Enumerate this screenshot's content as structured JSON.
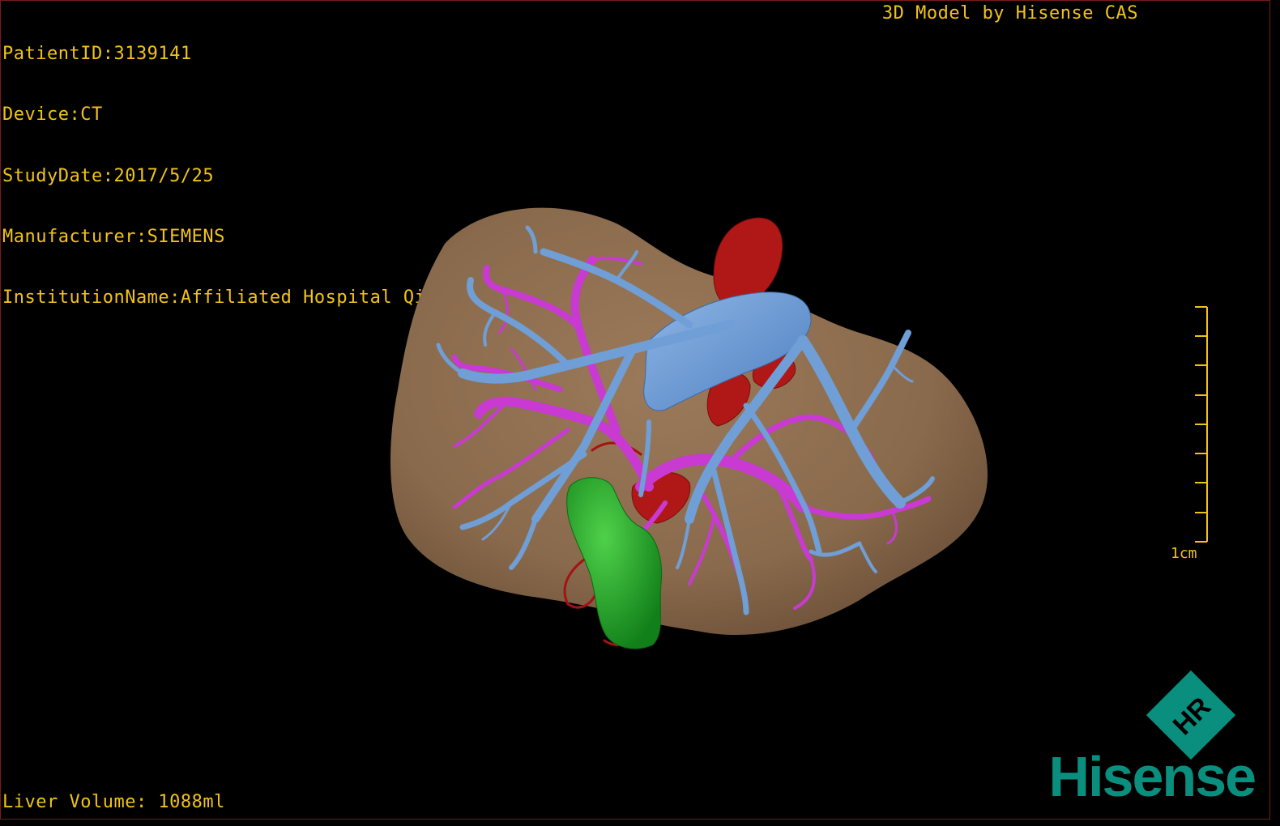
{
  "overlay": {
    "patient_line": "PatientID:3139141",
    "device_line": "Device:CT",
    "study_date_line": "StudyDate:2017/5/25",
    "manufacturer_line": "Manufacturer:SIEMENS",
    "institution_line": "InstitutionName:Affiliated Hospital Qingdao University-C",
    "model_credit": "3D Model by Hisense CAS",
    "liver_volume_line": "Liver Volume: 1088ml"
  },
  "scale_bar": {
    "label": "1cm",
    "tick_count": 9
  },
  "logo": {
    "wordmark": "Hisense",
    "badge_text": "HR"
  },
  "colors": {
    "overlay_text": "#f2c318",
    "liver": "#8c6c4e",
    "portal_vein": "#6f9fd6",
    "hepatic_artery": "#c83ad1",
    "arterial_vessels": "#b01818",
    "gallbladder": "#21a524",
    "brand": "#0a8f7f",
    "viewport_border": "#7a1b1b"
  }
}
